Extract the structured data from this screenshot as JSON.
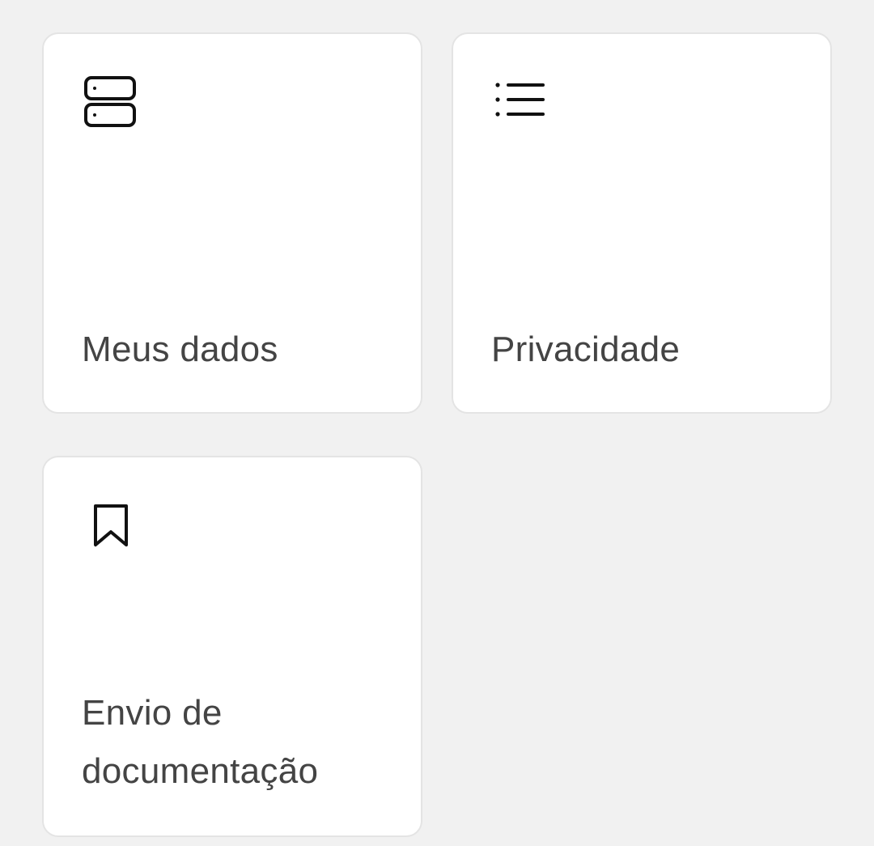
{
  "menu": {
    "items": [
      {
        "label": "Meus dados",
        "icon": "server-icon"
      },
      {
        "label": "Privacidade",
        "icon": "list-icon"
      },
      {
        "label": "Envio de documentação",
        "icon": "bookmark-icon"
      }
    ]
  },
  "colors": {
    "background": "#f1f1f1",
    "card": "#ffffff",
    "card_border": "#e4e4e4",
    "label_text": "#444444",
    "icon": "#111111"
  }
}
